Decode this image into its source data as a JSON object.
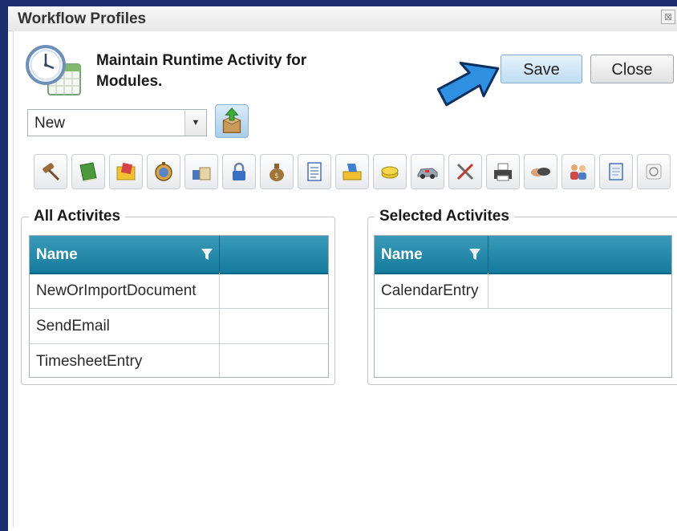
{
  "window": {
    "title": "Workflow Profiles",
    "close_glyph": "⊠"
  },
  "header": {
    "heading": "Maintain Runtime Activity for Modules.",
    "icon": "clock-calendar-icon"
  },
  "buttons": {
    "save_label": "Save",
    "close_label": "Close"
  },
  "profile_select": {
    "value": "New",
    "dropdown_glyph": "▼"
  },
  "toolbar": {
    "icons": [
      "gavel-icon",
      "book-icon",
      "folder-icon",
      "stopwatch-icon",
      "printer-box-icon",
      "lock-icon",
      "money-bag-icon",
      "document-icon",
      "inbox-icon",
      "coins-icon",
      "car-icon",
      "tools-icon",
      "printer-icon",
      "handshake-icon",
      "people-icon",
      "scroll-icon",
      "clock-badge-icon"
    ]
  },
  "all_activities": {
    "legend": "All Activites",
    "column_header": "Name",
    "rows": [
      "NewOrImportDocument",
      "SendEmail",
      "TimesheetEntry"
    ]
  },
  "selected_activities": {
    "legend": "Selected Activites",
    "column_header": "Name",
    "rows": [
      "CalendarEntry"
    ]
  },
  "colors": {
    "frame": "#1c2d6e",
    "grid_header": "#1f85a7",
    "save_button": "#bfdcf2",
    "arrow": "#2f8fe0"
  }
}
